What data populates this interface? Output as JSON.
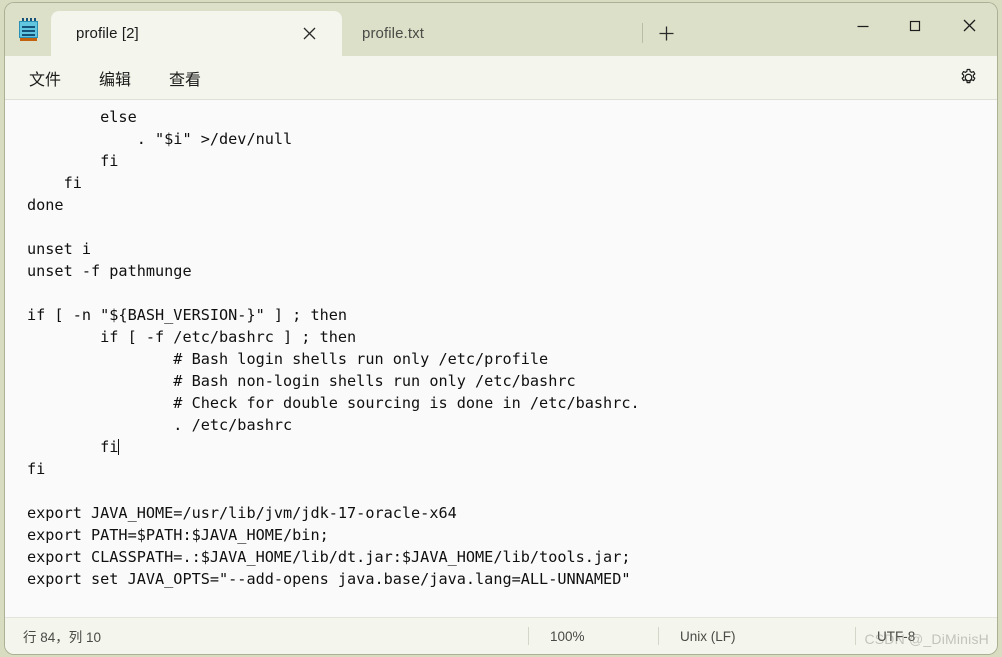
{
  "window": {
    "app_icon": "notepad-icon",
    "controls": {
      "minimize": "minimize-icon",
      "maximize": "maximize-icon",
      "close": "close-icon"
    }
  },
  "tabs": {
    "items": [
      {
        "label": "profile [2]",
        "active": true,
        "close_icon": "close-icon"
      },
      {
        "label": "profile.txt",
        "active": false
      }
    ],
    "new_tab_label": "+"
  },
  "menubar": {
    "items": [
      {
        "label": "文件"
      },
      {
        "label": "编辑"
      },
      {
        "label": "查看"
      }
    ],
    "settings_icon": "gear-icon"
  },
  "editor": {
    "content_before_caret": "        else\n            . \"$i\" >/dev/null\n        fi\n    fi\ndone\n\nunset i\nunset -f pathmunge\n\nif [ -n \"${BASH_VERSION-}\" ] ; then\n        if [ -f /etc/bashrc ] ; then\n                # Bash login shells run only /etc/profile\n                # Bash non-login shells run only /etc/bashrc\n                # Check for double sourcing is done in /etc/bashrc.\n                . /etc/bashrc\n        fi",
    "content_after_caret": "\nfi\n\nexport JAVA_HOME=/usr/lib/jvm/jdk-17-oracle-x64\nexport PATH=$PATH:$JAVA_HOME/bin;\nexport CLASSPATH=.:$JAVA_HOME/lib/dt.jar:$JAVA_HOME/lib/tools.jar;\nexport set JAVA_OPTS=\"--add-opens java.base/java.lang=ALL-UNNAMED\""
  },
  "statusbar": {
    "position": "行 84，列 10",
    "zoom": "100%",
    "line_ending": "Unix (LF)",
    "encoding": "UTF-8"
  },
  "watermark": {
    "text": "CSDN @_DiMinisH"
  },
  "colors": {
    "titlebar": "#dde0c9",
    "active_tab": "#f4f5ec",
    "editor_bg": "#fafafa",
    "text": "#101010"
  }
}
